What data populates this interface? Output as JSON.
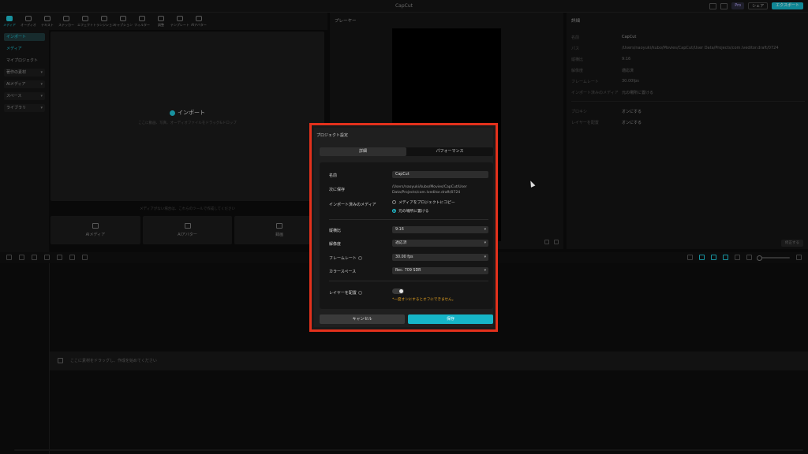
{
  "app": {
    "title": "CapCut"
  },
  "titlebar": {
    "pro": "Pro",
    "share": "シェア",
    "export": "エクスポート"
  },
  "toolbar": {
    "tools": [
      "メディア",
      "オーディオ",
      "テキスト",
      "ステッカー",
      "エフェクト",
      "トランジション",
      "キャプション",
      "フィルター",
      "調整",
      "テンプレート",
      "AIアバター"
    ]
  },
  "sidebar": {
    "items": [
      "インポート",
      "メディア",
      "マイプロジェクト",
      "著作の素材",
      "AIメディア",
      "スペース",
      "ライブラリ"
    ]
  },
  "media": {
    "import_label": "インポート",
    "import_hint": "ここに動画、写真、オーディオファイルをドラッグ&ドロップ",
    "caption": "メディアがない場合は、これらのツールで作成してください",
    "cards": [
      "AIメディア",
      "AIアバター",
      "録画"
    ]
  },
  "player": {
    "title": "プレーヤー"
  },
  "details": {
    "title": "詳細",
    "rows": [
      {
        "label": "名前",
        "value": "CapCut"
      },
      {
        "label": "パス",
        "value": "/Users/naoyuki/kubo/Movies/CapCut/User Data/Projects/com.lveditor.draft/0724"
      },
      {
        "label": "縦横比",
        "value": "9:16"
      },
      {
        "label": "解像度",
        "value": "適応済"
      },
      {
        "label": "フレームレート",
        "value": "30.00fps"
      },
      {
        "label": "インポート済みのメディア",
        "value": "元の場所に置ける"
      },
      {
        "label": "プロキシ",
        "value": "オンにする"
      },
      {
        "label": "レイヤーを配置",
        "value": "オンにする"
      }
    ],
    "change_button": "修正する"
  },
  "timeline": {
    "drop_hint": "ここに素材をドラッグし、作成を始めてください"
  },
  "dialog": {
    "title": "プロジェクト設定",
    "tabs": [
      "詳細",
      "パフォーマンス"
    ],
    "name_label": "名前",
    "name_value": "CapCut",
    "save_to_label": "次に保存",
    "save_to_value": "/Users/naoyuki/kubo/Movies/CapCut/User Data/Projects/com.lveditor.draft/0724",
    "imported_media_label": "インポート済みのメディア",
    "radio_copy": "メディアをプロジェクトにコピー",
    "radio_keep": "元の場所に置ける",
    "aspect_label": "縦横比",
    "aspect_value": "9:16",
    "resolution_label": "解像度",
    "resolution_value": "適応済",
    "framerate_label": "フレームレート",
    "framerate_value": "30.00 fps",
    "colorspace_label": "カラースペース",
    "colorspace_value": "Rec. 709 SDR",
    "layer_label": "レイヤーを配置",
    "layer_warning": "*一度オンにするとオフにできません。",
    "cancel": "キャンセル",
    "save": "保存"
  },
  "colors": {
    "accent": "#16b5c7",
    "highlight": "#e3311c",
    "warning": "#e5a322"
  }
}
